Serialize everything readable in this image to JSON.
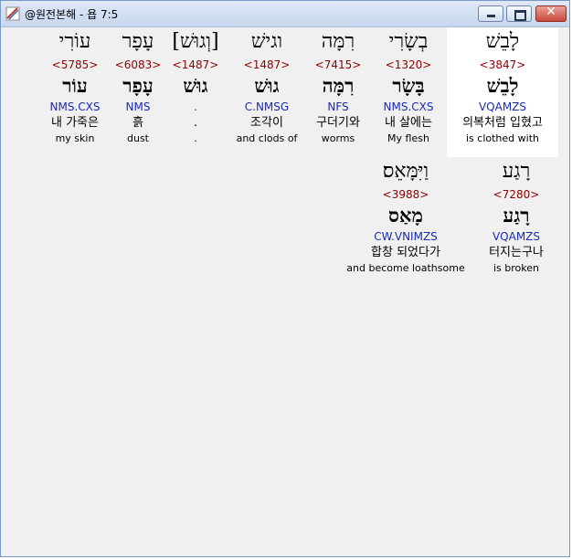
{
  "window": {
    "title": "@원전본해 - 욥 7:5",
    "close_glyph": "✕"
  },
  "rows": [
    {
      "words": [
        {
          "hebrew": "לָבֵשׁ",
          "strong": "<3847>",
          "lemma": "לָבֵשׁ",
          "parse": "VQAMZS",
          "korean": "의복처럼 입혔고",
          "english": "is clothed with",
          "selected": true
        },
        {
          "hebrew": "בְשָׂרִי",
          "strong": "<1320>",
          "lemma": "בָּשָׂר",
          "parse": "NMS.CXS",
          "korean": "내 살에는",
          "english": "My flesh"
        },
        {
          "hebrew": "רִמָּה",
          "strong": "<7415>",
          "lemma": "רִמָּה",
          "parse": "NFS",
          "korean": "구더기와",
          "english": "worms"
        },
        {
          "hebrew": "וגישׁ",
          "strong": "<1487>",
          "lemma": "גוּשׁ",
          "parse": "C.NMSG",
          "korean": "조각이",
          "english": "and clods of"
        },
        {
          "hebrew": "[וְגוּשׁ]",
          "strong": "<1487>",
          "lemma": "גוּשׁ",
          "parse": ".",
          "korean": ".",
          "english": "."
        },
        {
          "hebrew": "עָפָר",
          "strong": "<6083>",
          "lemma": "עָפָר",
          "parse": "NMS",
          "korean": "흙",
          "english": "dust"
        },
        {
          "hebrew": "עוֹרִי",
          "strong": "<5785>",
          "lemma": "עוֹר",
          "parse": "NMS.CXS",
          "korean": "내 가죽은",
          "english": "my skin"
        }
      ]
    },
    {
      "words": [
        {
          "hebrew": "רָגַע",
          "strong": "<7280>",
          "lemma": "רָגַע",
          "parse": "VQAMZS",
          "korean": "터지는구나",
          "english": "is broken"
        },
        {
          "hebrew": "וַיִּמָּאֵס׃",
          "strong": "<3988>",
          "lemma": "מָאַס",
          "parse": "CW.VNIMZS",
          "korean": "합창 되었다가",
          "english": "and become loathsome"
        }
      ]
    }
  ]
}
